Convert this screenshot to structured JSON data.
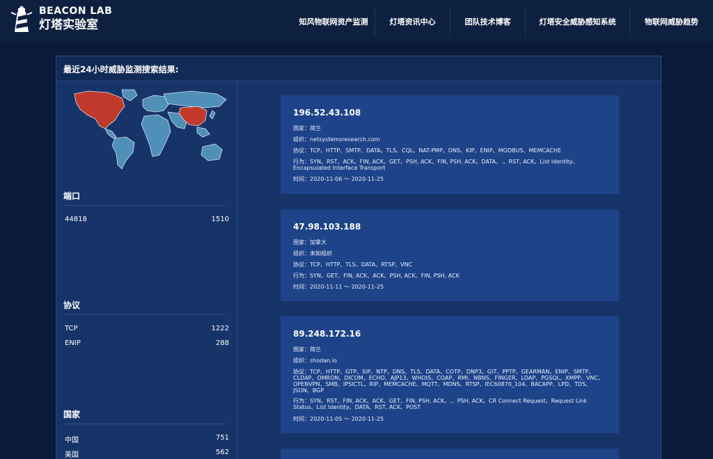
{
  "header": {
    "logo_en": "BEACON LAB",
    "logo_cn": "灯塔实验室",
    "nav": [
      {
        "label": "知风物联网资产监测"
      },
      {
        "label": "灯塔资讯中心"
      },
      {
        "label": "团队技术博客"
      },
      {
        "label": "灯塔安全威胁感知系统"
      },
      {
        "label": "物联网威胁趋势"
      }
    ]
  },
  "panel": {
    "title": "最近24小时威胁监测搜索结果:"
  },
  "sidebar": {
    "port": {
      "title": "端口",
      "rows": [
        {
          "name": "44818",
          "count": "1510"
        }
      ]
    },
    "protocol": {
      "title": "协议",
      "rows": [
        {
          "name": "TCP",
          "count": "1222"
        },
        {
          "name": "ENIP",
          "count": "288"
        }
      ]
    },
    "country": {
      "title": "国家",
      "rows": [
        {
          "name": "中国",
          "count": "751"
        },
        {
          "name": "美国",
          "count": "562"
        }
      ]
    }
  },
  "results": [
    {
      "ip": "196.52.43.108",
      "country": "国家：荷兰",
      "org": "组织：netsystemsresearch.com",
      "protocols": "协议：TCP、HTTP、SMTP、DATA、TLS、CQL、NAT-PMP、DNS、KIP、ENIP、MODBUS、MEMCACHE",
      "behaviors": "行为：SYN、RST、ACK、FIN, ACK、GET、PSH, ACK、FIN, PSH, ACK、DATA、.、RST, ACK、List Identity、Encapsulated Interface Transport",
      "time": "时间：2020-11-06 ～ 2020-11-25"
    },
    {
      "ip": "47.98.103.188",
      "country": "国家：加拿大",
      "org": "组织：未知组织",
      "protocols": "协议：TCP、HTTP、TLS、DATA、RTSP、VNC",
      "behaviors": "行为：SYN、GET、FIN, ACK、ACK、PSH, ACK、FIN, PSH, ACK",
      "time": "时间：2020-11-11 ～ 2020-11-25"
    },
    {
      "ip": "89.248.172.16",
      "country": "国家：荷兰",
      "org": "组织：shodan.io",
      "protocols": "协议：TCP、HTTP、GTP、SIP、NTP、DNS、TLS、DATA、COTP、DNP3、GIT、PPTP、GEARMAN、ENIP、SMTP、CLDAP、OMRON、DICOM、ECHO、AJP13、WHOIS、COAP、RMI、NBNS、FINGER、LDAP、PGSQL、XMPP、VNC、OPENVPN、SMB、IPSICTL、RIP、MEMCACHE、MQTT、MDNS、RTSP、IEC60870_104、BACAPP、LPD、TDS、JSON、BGP",
      "behaviors": "行为：SYN、RST、FIN, ACK、ACK、GET、FIN, PSH, ACK、.、PSH, ACK、CR Connect Request、Request Link Status、List Identity、DATA、RST, ACK、POST",
      "time": "时间：2020-11-05 ～ 2020-11-25"
    }
  ],
  "colors": {
    "page_bg": "#0b1a3a",
    "panel_bg": "#173469",
    "card_bg": "#1e4389",
    "map_highlight": "#c0392b",
    "map_base": "#4f8fb8"
  }
}
